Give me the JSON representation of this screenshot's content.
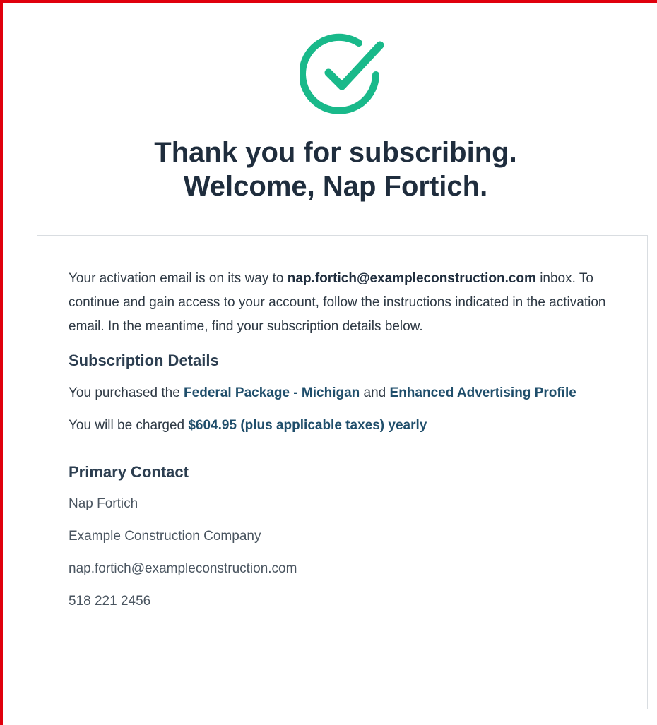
{
  "colors": {
    "frame_border": "#e0000d",
    "check_green": "#19b98a",
    "headline": "#1f2d3d",
    "highlight_link": "#1f4e6b",
    "card_border": "#d9dde1"
  },
  "icons": {
    "success": "check-circle-icon"
  },
  "headline": {
    "line1": "Thank you for subscribing.",
    "line2": "Welcome, Nap Fortich."
  },
  "intro": {
    "prefix": "Your activation email is on its way to ",
    "email": "nap.fortich@exampleconstruction.com",
    "suffix": " inbox. To continue and gain access to your account, follow the instructions indicated in the activation email. In the meantime, find your subscription details below."
  },
  "subscription": {
    "title": "Subscription Details",
    "purchase_prefix": "You purchased the ",
    "package": "Federal Package - Michigan",
    "and": " and ",
    "addon": "Enhanced Advertising Profile",
    "charge_prefix": "You will be charged ",
    "charge": "$604.95 (plus applicable taxes) yearly"
  },
  "contact": {
    "title": "Primary Contact",
    "name": "Nap Fortich",
    "company": "Example Construction Company",
    "email": "nap.fortich@exampleconstruction.com",
    "phone": "518 221 2456"
  }
}
